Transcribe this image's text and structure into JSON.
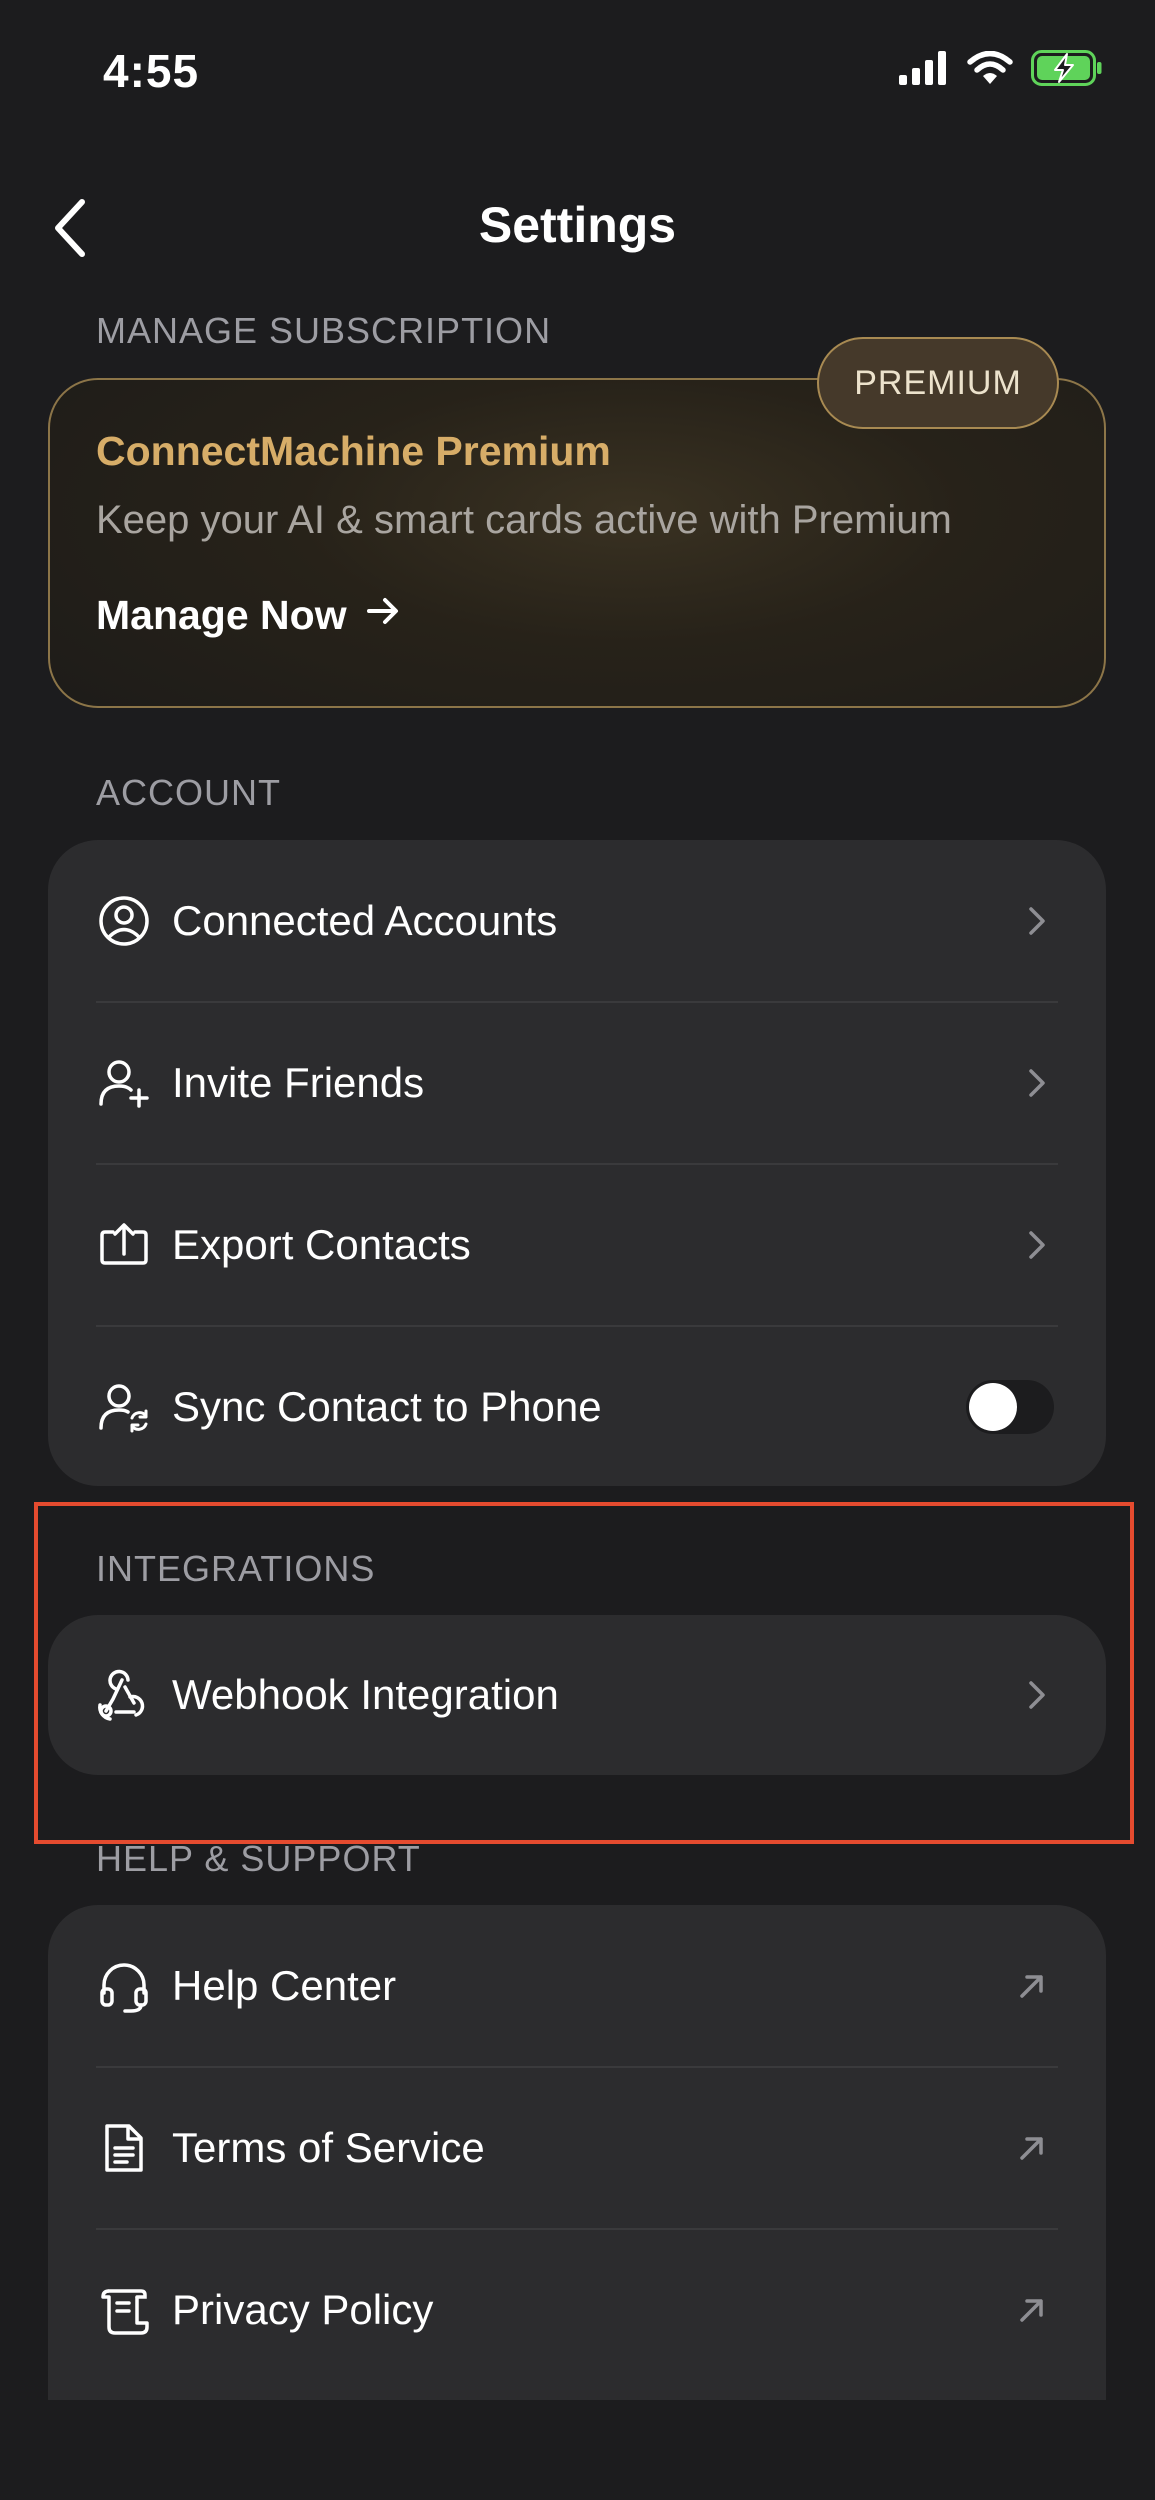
{
  "status_bar": {
    "time": "4:55",
    "icons": [
      "cellular-signal-icon",
      "wifi-icon",
      "battery-charging-icon"
    ]
  },
  "header": {
    "title": "Settings",
    "back_icon": "chevron-left-icon"
  },
  "subscription": {
    "section_label": "MANAGE SUBSCRIPTION",
    "badge": "PREMIUM",
    "title": "ConnectMachine Premium",
    "description": "Keep your AI & smart cards active with Premium",
    "cta": "Manage Now",
    "cta_icon": "arrow-right-icon"
  },
  "account": {
    "section_label": "ACCOUNT",
    "items": [
      {
        "label": "Connected Accounts",
        "icon": "user-circle-icon",
        "trailing": "chevron-right-icon"
      },
      {
        "label": "Invite Friends",
        "icon": "user-plus-icon",
        "trailing": "chevron-right-icon"
      },
      {
        "label": "Export Contacts",
        "icon": "export-icon",
        "trailing": "chevron-right-icon"
      },
      {
        "label": "Sync Contact to Phone",
        "icon": "user-sync-icon",
        "trailing": "toggle",
        "toggle_on": false
      }
    ]
  },
  "integrations": {
    "section_label": "INTEGRATIONS",
    "items": [
      {
        "label": "Webhook Integration",
        "icon": "webhook-icon",
        "trailing": "chevron-right-icon"
      }
    ]
  },
  "help_support": {
    "section_label": "HELP & SUPPORT",
    "items": [
      {
        "label": "Help Center",
        "icon": "headset-icon",
        "trailing": "external-link-icon"
      },
      {
        "label": "Terms of Service",
        "icon": "document-icon",
        "trailing": "external-link-icon"
      },
      {
        "label": "Privacy Policy",
        "icon": "scroll-icon",
        "trailing": "external-link-icon"
      }
    ]
  },
  "colors": {
    "background": "#1c1c1e",
    "card": "#2c2c2e",
    "section_label": "#9d9da3",
    "premium_gold": "#d7ad68",
    "highlight": "#e54b2f"
  }
}
